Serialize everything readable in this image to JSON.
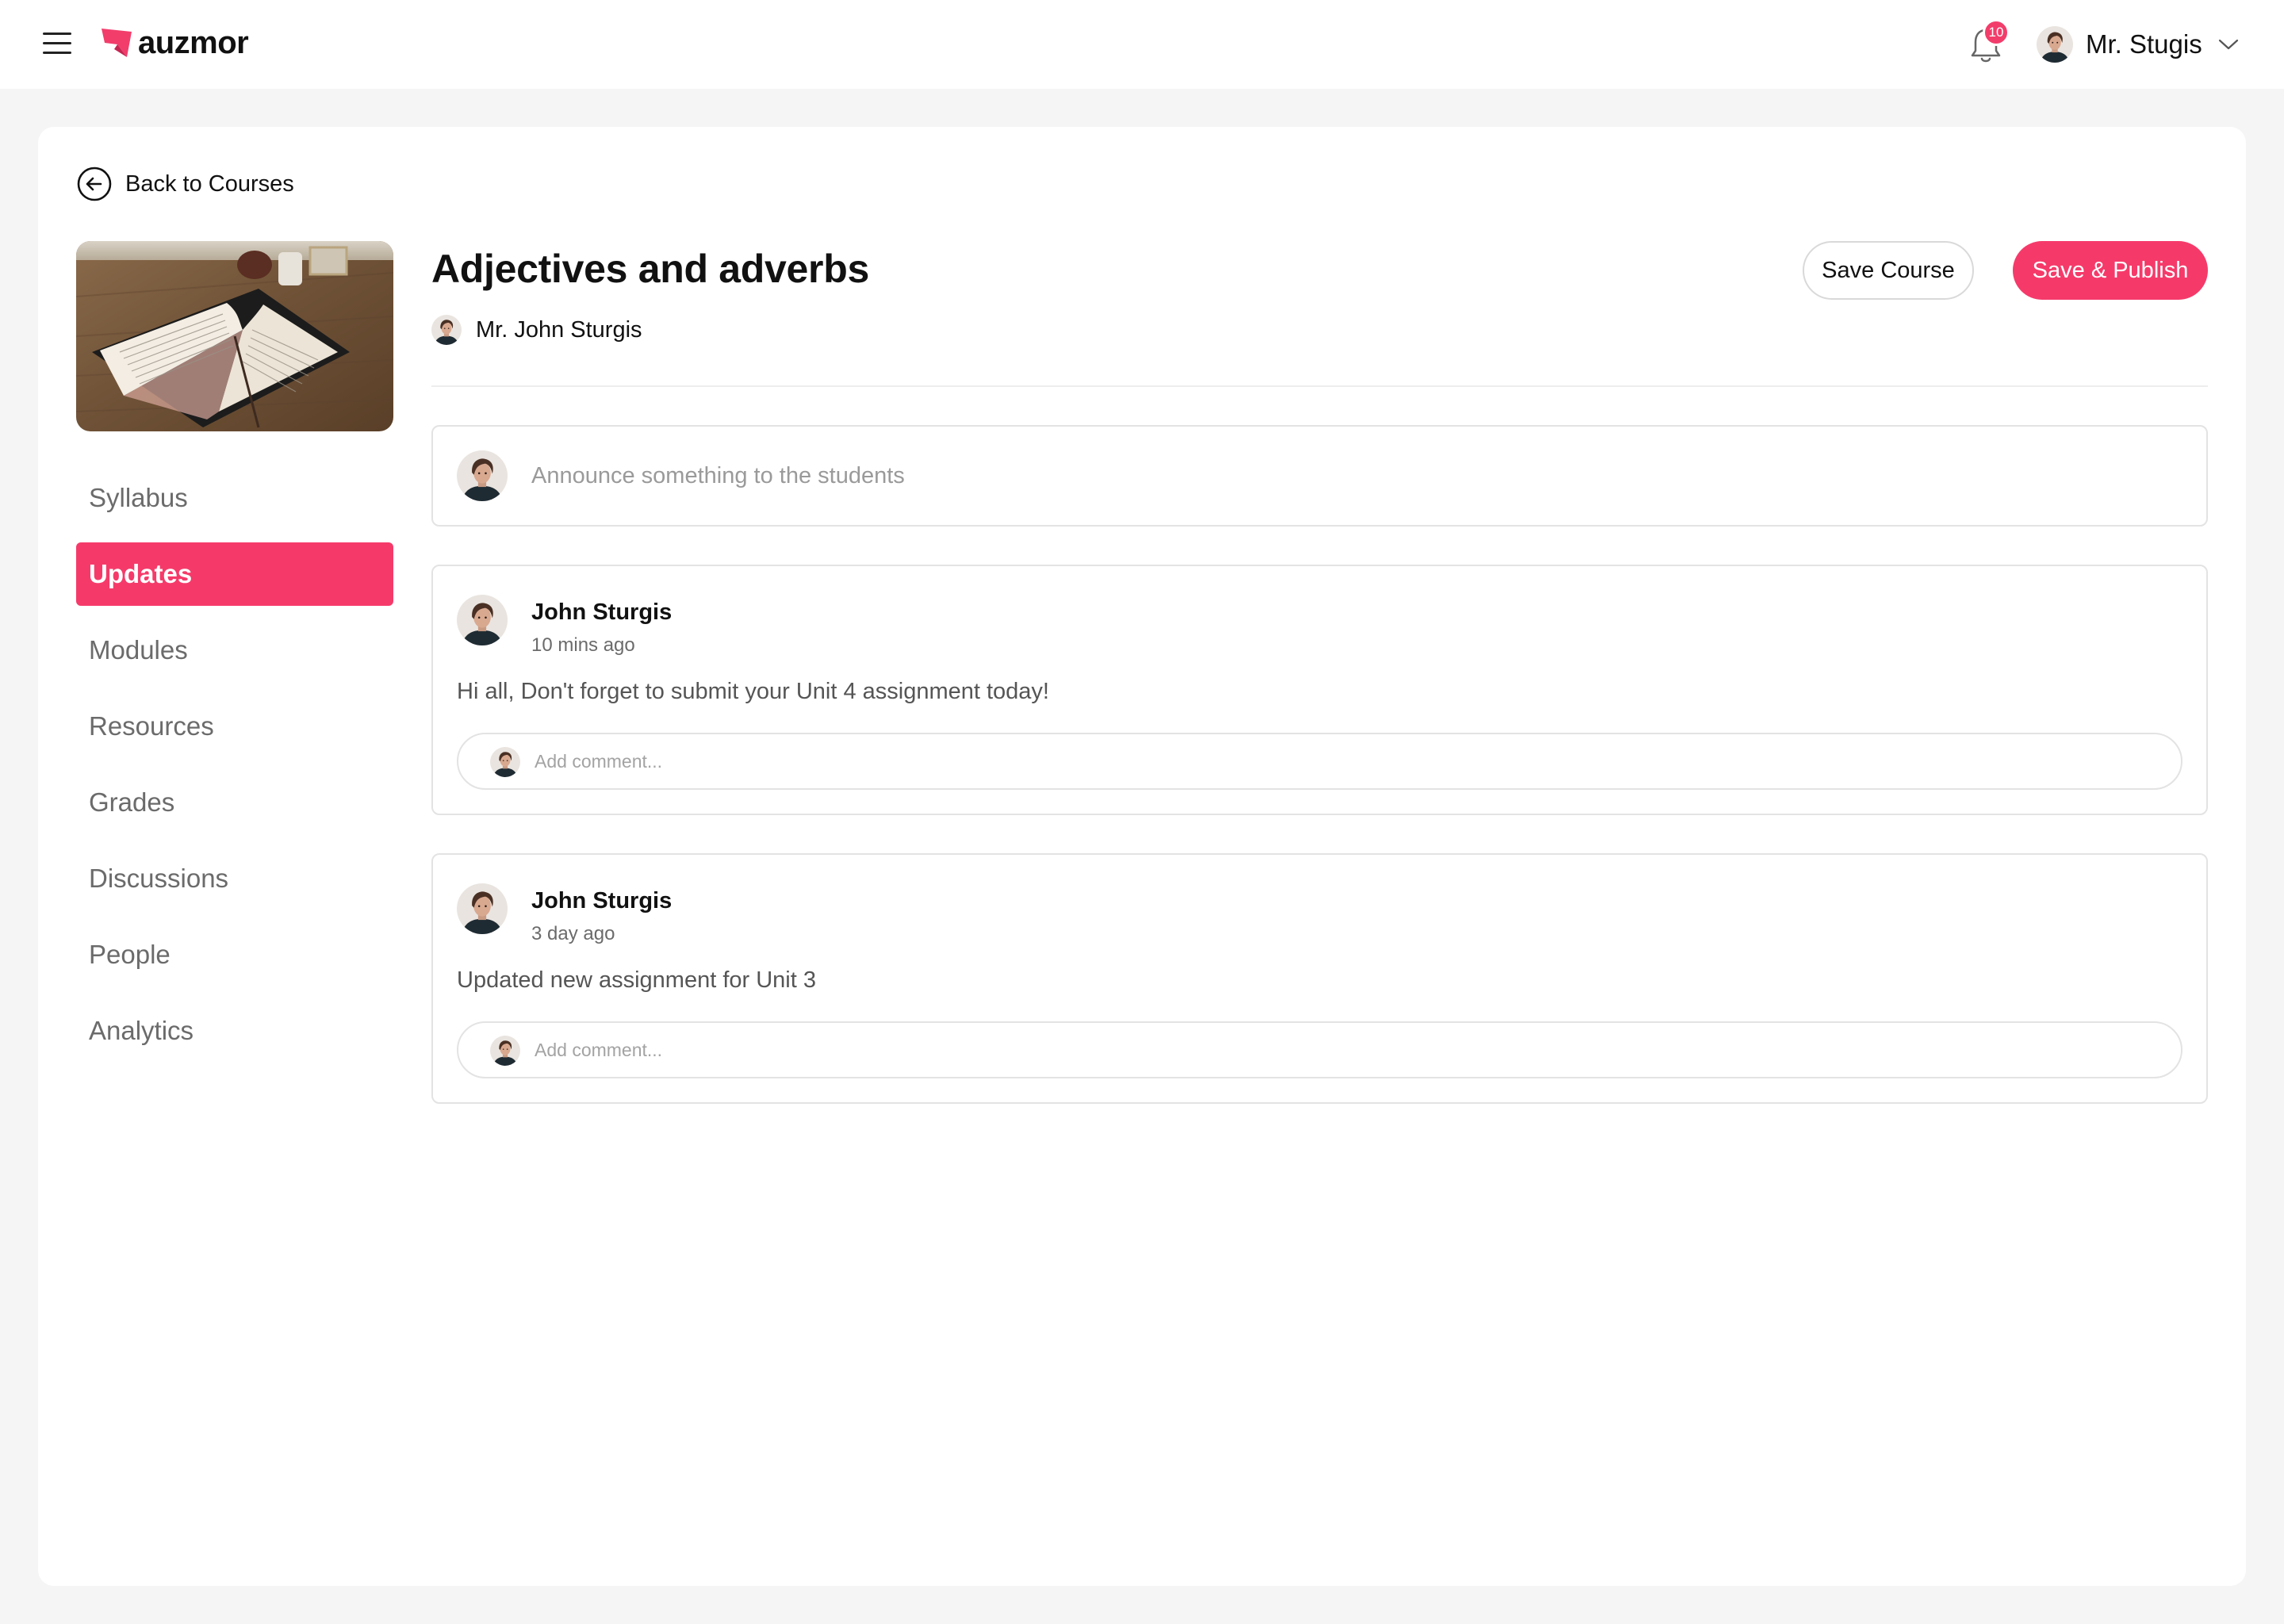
{
  "app": {
    "brand_name": "auzmor",
    "brand_color": "#f23d6b",
    "menu_icon": "hamburger-menu-icon"
  },
  "header": {
    "notification_count": "10",
    "notification_icon": "bell-icon",
    "user_name": "Mr. Stugis",
    "dropdown_icon": "chevron-down-icon"
  },
  "course": {
    "back_label": "Back to Courses",
    "back_icon": "arrow-left-circle-icon",
    "title": "Adjectives and adverbs",
    "author": "Mr. John Sturgis",
    "image_description_icon": "open-book-photo",
    "save_label": "Save Course",
    "publish_label": "Save & Publish"
  },
  "sidebar": {
    "active_index": 1,
    "items": [
      {
        "label": "Syllabus"
      },
      {
        "label": "Updates"
      },
      {
        "label": "Modules"
      },
      {
        "label": "Resources"
      },
      {
        "label": "Grades"
      },
      {
        "label": "Discussions"
      },
      {
        "label": "People"
      },
      {
        "label": "Analytics"
      }
    ]
  },
  "announce": {
    "placeholder": "Announce something to the students"
  },
  "posts": [
    {
      "author": "John Sturgis",
      "time": "10 mins ago",
      "body": "Hi all, Don't forget to submit your Unit 4 assignment today!",
      "comment_placeholder": "Add comment..."
    },
    {
      "author": "John Sturgis",
      "time": "3 day ago",
      "body": "Updated new assignment for Unit 3",
      "comment_placeholder": "Add comment..."
    }
  ]
}
